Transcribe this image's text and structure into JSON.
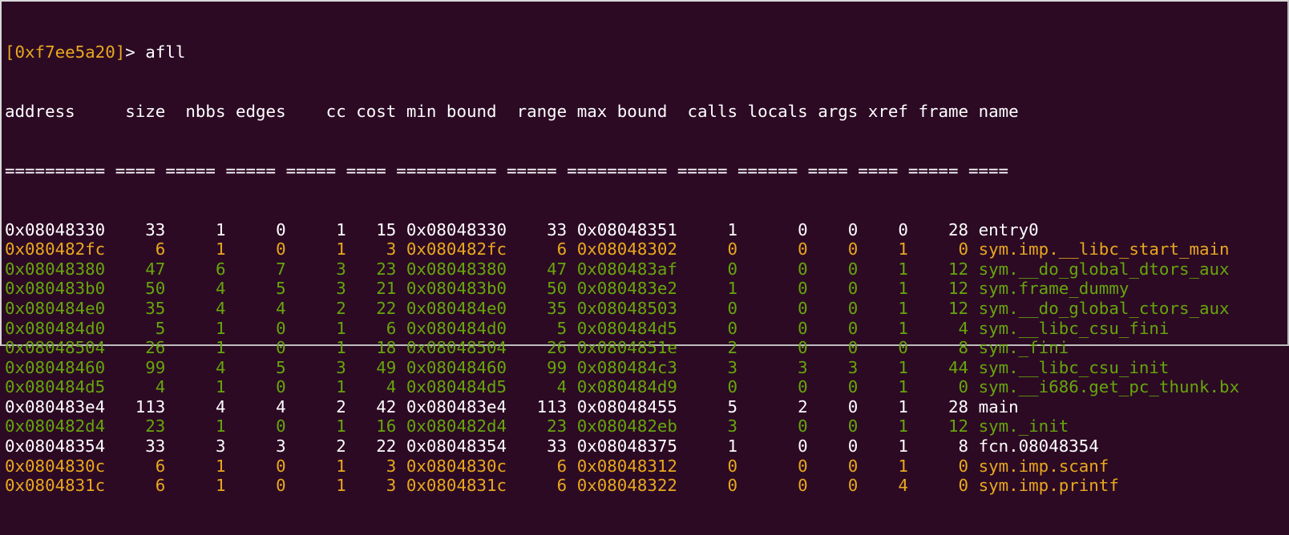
{
  "prompt": {
    "address": "[0xf7ee5a20]",
    "symbol": "> ",
    "command": "afll"
  },
  "colors": {
    "background": "#2c0a24",
    "white": "#ffffff",
    "orange": "#e8a81e",
    "green": "#66a60c"
  },
  "columns": [
    {
      "key": "address",
      "label": "address",
      "width": 11,
      "align": "left"
    },
    {
      "key": "size",
      "label": "size",
      "width": 4,
      "align": "right"
    },
    {
      "key": "nbbs",
      "label": "nbbs",
      "width": 5,
      "align": "right"
    },
    {
      "key": "edges",
      "label": "edges",
      "width": 5,
      "align": "right"
    },
    {
      "key": "cc",
      "label": "cc",
      "width": 5,
      "align": "right"
    },
    {
      "key": "cost",
      "label": "cost",
      "width": 4,
      "align": "right"
    },
    {
      "key": "min_bound",
      "label": "min bound",
      "width": 10,
      "align": "left"
    },
    {
      "key": "range",
      "label": "range",
      "width": 5,
      "align": "right"
    },
    {
      "key": "max_bound",
      "label": "max bound",
      "width": 10,
      "align": "left"
    },
    {
      "key": "calls",
      "label": "calls",
      "width": 5,
      "align": "right"
    },
    {
      "key": "locals",
      "label": "locals",
      "width": 6,
      "align": "right"
    },
    {
      "key": "args",
      "label": "args",
      "width": 4,
      "align": "right"
    },
    {
      "key": "xref",
      "label": "xref",
      "width": 4,
      "align": "right"
    },
    {
      "key": "frame",
      "label": "frame",
      "width": 5,
      "align": "right"
    },
    {
      "key": "name",
      "label": "name",
      "width": 0,
      "align": "left"
    }
  ],
  "separator": "========== ==== ===== ===== ===== ==== ========== ===== ========== ===== ====== ==== ==== ===== ====",
  "rows": [
    {
      "color": "white",
      "address": "0x08048330",
      "size": "33",
      "nbbs": "1",
      "edges": "0",
      "cc": "1",
      "cost": "15",
      "min_bound": "0x08048330",
      "range": "33",
      "max_bound": "0x08048351",
      "calls": "1",
      "locals": "0",
      "args": "0",
      "xref": "0",
      "frame": "28",
      "name": "entry0"
    },
    {
      "color": "orange",
      "address": "0x080482fc",
      "size": "6",
      "nbbs": "1",
      "edges": "0",
      "cc": "1",
      "cost": "3",
      "min_bound": "0x080482fc",
      "range": "6",
      "max_bound": "0x08048302",
      "calls": "0",
      "locals": "0",
      "args": "0",
      "xref": "1",
      "frame": "0",
      "name": "sym.imp.__libc_start_main"
    },
    {
      "color": "green",
      "address": "0x08048380",
      "size": "47",
      "nbbs": "6",
      "edges": "7",
      "cc": "3",
      "cost": "23",
      "min_bound": "0x08048380",
      "range": "47",
      "max_bound": "0x080483af",
      "calls": "0",
      "locals": "0",
      "args": "0",
      "xref": "1",
      "frame": "12",
      "name": "sym.__do_global_dtors_aux"
    },
    {
      "color": "green",
      "address": "0x080483b0",
      "size": "50",
      "nbbs": "4",
      "edges": "5",
      "cc": "3",
      "cost": "21",
      "min_bound": "0x080483b0",
      "range": "50",
      "max_bound": "0x080483e2",
      "calls": "1",
      "locals": "0",
      "args": "0",
      "xref": "1",
      "frame": "12",
      "name": "sym.frame_dummy"
    },
    {
      "color": "green",
      "address": "0x080484e0",
      "size": "35",
      "nbbs": "4",
      "edges": "4",
      "cc": "2",
      "cost": "22",
      "min_bound": "0x080484e0",
      "range": "35",
      "max_bound": "0x08048503",
      "calls": "0",
      "locals": "0",
      "args": "0",
      "xref": "1",
      "frame": "12",
      "name": "sym.__do_global_ctors_aux"
    },
    {
      "color": "green",
      "address": "0x080484d0",
      "size": "5",
      "nbbs": "1",
      "edges": "0",
      "cc": "1",
      "cost": "6",
      "min_bound": "0x080484d0",
      "range": "5",
      "max_bound": "0x080484d5",
      "calls": "0",
      "locals": "0",
      "args": "0",
      "xref": "1",
      "frame": "4",
      "name": "sym.__libc_csu_fini"
    },
    {
      "color": "green",
      "address": "0x08048504",
      "size": "26",
      "nbbs": "1",
      "edges": "0",
      "cc": "1",
      "cost": "18",
      "min_bound": "0x08048504",
      "range": "26",
      "max_bound": "0x0804851e",
      "calls": "2",
      "locals": "0",
      "args": "0",
      "xref": "0",
      "frame": "8",
      "name": "sym._fini"
    },
    {
      "color": "green",
      "address": "0x08048460",
      "size": "99",
      "nbbs": "4",
      "edges": "5",
      "cc": "3",
      "cost": "49",
      "min_bound": "0x08048460",
      "range": "99",
      "max_bound": "0x080484c3",
      "calls": "3",
      "locals": "3",
      "args": "3",
      "xref": "1",
      "frame": "44",
      "name": "sym.__libc_csu_init"
    },
    {
      "color": "green",
      "address": "0x080484d5",
      "size": "4",
      "nbbs": "1",
      "edges": "0",
      "cc": "1",
      "cost": "4",
      "min_bound": "0x080484d5",
      "range": "4",
      "max_bound": "0x080484d9",
      "calls": "0",
      "locals": "0",
      "args": "0",
      "xref": "1",
      "frame": "0",
      "name": "sym.__i686.get_pc_thunk.bx"
    },
    {
      "color": "white",
      "address": "0x080483e4",
      "size": "113",
      "nbbs": "4",
      "edges": "4",
      "cc": "2",
      "cost": "42",
      "min_bound": "0x080483e4",
      "range": "113",
      "max_bound": "0x08048455",
      "calls": "5",
      "locals": "2",
      "args": "0",
      "xref": "1",
      "frame": "28",
      "name": "main"
    },
    {
      "color": "green",
      "address": "0x080482d4",
      "size": "23",
      "nbbs": "1",
      "edges": "0",
      "cc": "1",
      "cost": "16",
      "min_bound": "0x080482d4",
      "range": "23",
      "max_bound": "0x080482eb",
      "calls": "3",
      "locals": "0",
      "args": "0",
      "xref": "1",
      "frame": "12",
      "name": "sym._init"
    },
    {
      "color": "white",
      "address": "0x08048354",
      "size": "33",
      "nbbs": "3",
      "edges": "3",
      "cc": "2",
      "cost": "22",
      "min_bound": "0x08048354",
      "range": "33",
      "max_bound": "0x08048375",
      "calls": "1",
      "locals": "0",
      "args": "0",
      "xref": "1",
      "frame": "8",
      "name": "fcn.08048354"
    },
    {
      "color": "orange",
      "address": "0x0804830c",
      "size": "6",
      "nbbs": "1",
      "edges": "0",
      "cc": "1",
      "cost": "3",
      "min_bound": "0x0804830c",
      "range": "6",
      "max_bound": "0x08048312",
      "calls": "0",
      "locals": "0",
      "args": "0",
      "xref": "1",
      "frame": "0",
      "name": "sym.imp.scanf"
    },
    {
      "color": "orange",
      "address": "0x0804831c",
      "size": "6",
      "nbbs": "1",
      "edges": "0",
      "cc": "1",
      "cost": "3",
      "min_bound": "0x0804831c",
      "range": "6",
      "max_bound": "0x08048322",
      "calls": "0",
      "locals": "0",
      "args": "0",
      "xref": "4",
      "frame": "0",
      "name": "sym.imp.printf"
    }
  ]
}
